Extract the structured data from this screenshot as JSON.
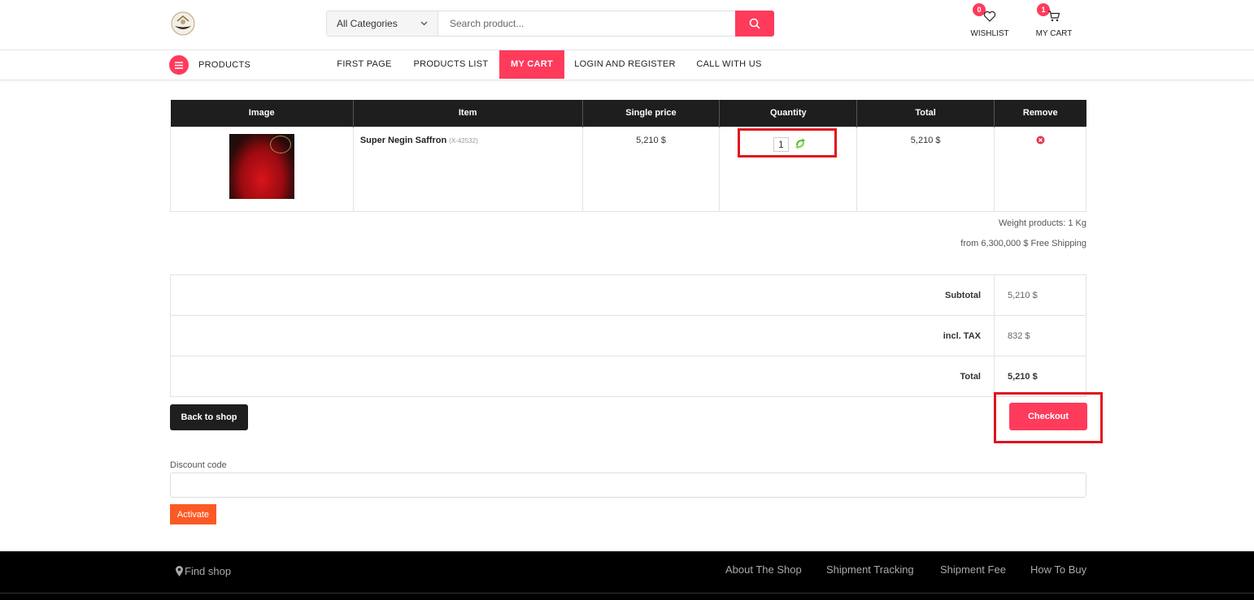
{
  "header": {
    "search": {
      "category": "All Categories",
      "placeholder": "Search product..."
    },
    "wishlist": {
      "label": "WISHLIST",
      "count": "0"
    },
    "cart": {
      "label": "MY CART",
      "count": "1"
    }
  },
  "nav": {
    "products_label": "PRODUCTS",
    "items": [
      {
        "label": "FIRST PAGE",
        "active": false
      },
      {
        "label": "PRODUCTS LIST",
        "active": false
      },
      {
        "label": "MY CART",
        "active": true
      },
      {
        "label": "LOGIN AND REGISTER",
        "active": false
      },
      {
        "label": "CALL WITH US",
        "active": false
      }
    ]
  },
  "cart": {
    "columns": [
      "Image",
      "Item",
      "Single price",
      "Quantity",
      "Total",
      "Remove"
    ],
    "rows": [
      {
        "name": "Super Negin Saffron",
        "code": "(X-42532)",
        "price": "5,210 $",
        "quantity": "1",
        "total": "5,210 $"
      }
    ],
    "weight": "Weight products: 1 Kg",
    "shipping": "from 6,300,000 $ Free Shipping"
  },
  "totals": {
    "subtotal_label": "Subtotal",
    "subtotal": "5,210 $",
    "tax_label": "incl. TAX",
    "tax": "832 $",
    "total_label": "Total",
    "total": "5,210 $"
  },
  "actions": {
    "back": "Back to shop",
    "checkout": "Checkout"
  },
  "discount": {
    "label": "Discount code",
    "value": "",
    "button": "Activate"
  },
  "footer": {
    "find_shop": "Find shop",
    "links": [
      "About The Shop",
      "Shipment Tracking",
      "Shipment Fee",
      "How To Buy"
    ]
  },
  "colors": {
    "accent": "#ff3b5c",
    "dark": "#1e1e1e",
    "activate": "#fb5a25",
    "highlight": "#e0141e"
  }
}
